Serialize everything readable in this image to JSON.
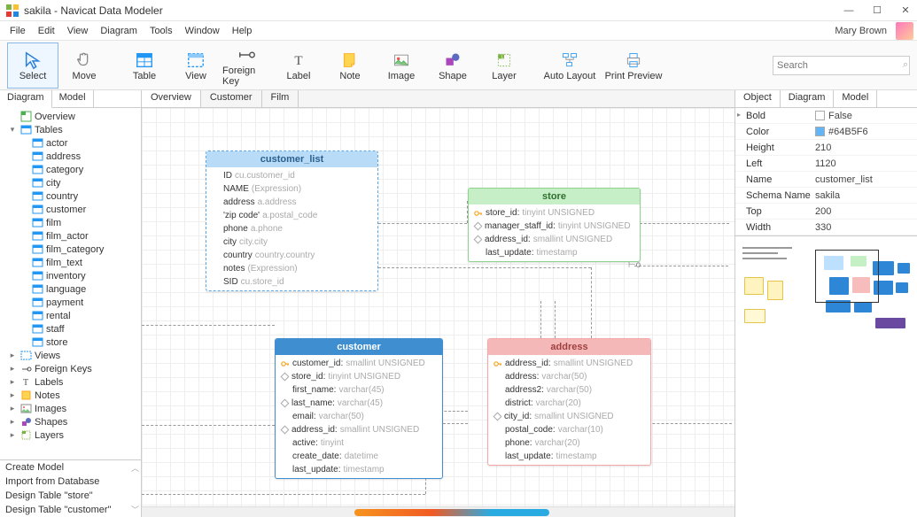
{
  "window": {
    "title": "sakila - Navicat Data Modeler"
  },
  "menu": {
    "items": [
      "File",
      "Edit",
      "View",
      "Diagram",
      "Tools",
      "Window",
      "Help"
    ],
    "user": "Mary Brown"
  },
  "toolbar": {
    "buttons": [
      {
        "id": "select",
        "label": "Select",
        "selected": true
      },
      {
        "id": "move",
        "label": "Move"
      },
      {
        "id": "table",
        "label": "Table"
      },
      {
        "id": "view",
        "label": "View"
      },
      {
        "id": "fk",
        "label": "Foreign Key"
      },
      {
        "id": "label",
        "label": "Label"
      },
      {
        "id": "note",
        "label": "Note"
      },
      {
        "id": "image",
        "label": "Image"
      },
      {
        "id": "shape",
        "label": "Shape"
      },
      {
        "id": "layer",
        "label": "Layer"
      },
      {
        "id": "autolayout",
        "label": "Auto Layout"
      },
      {
        "id": "printpreview",
        "label": "Print Preview"
      }
    ],
    "search_placeholder": "Search"
  },
  "left": {
    "tabs": [
      "Diagram",
      "Model"
    ],
    "tree": {
      "overview": "Overview",
      "tables_label": "Tables",
      "tables": [
        "actor",
        "address",
        "category",
        "city",
        "country",
        "customer",
        "film",
        "film_actor",
        "film_category",
        "film_text",
        "inventory",
        "language",
        "payment",
        "rental",
        "staff",
        "store"
      ],
      "groups": [
        "Views",
        "Foreign Keys",
        "Labels",
        "Notes",
        "Images",
        "Shapes",
        "Layers"
      ]
    },
    "bottom": [
      "Create Model",
      "Import from Database",
      "Design Table \"store\"",
      "Design Table \"customer\""
    ]
  },
  "canvas": {
    "tabs": [
      "Overview",
      "Customer",
      "Film"
    ],
    "entities": {
      "customer_list": {
        "title": "customer_list",
        "rows": [
          {
            "name": "ID",
            "type": "cu.customer_id"
          },
          {
            "name": "NAME",
            "type": "(Expression)"
          },
          {
            "name": "address",
            "type": "a.address"
          },
          {
            "name": "'zip code'",
            "type": "a.postal_code"
          },
          {
            "name": "phone",
            "type": "a.phone"
          },
          {
            "name": "city",
            "type": "city.city"
          },
          {
            "name": "country",
            "type": "country.country"
          },
          {
            "name": "notes",
            "type": "(Expression)"
          },
          {
            "name": "SID",
            "type": "cu.store_id"
          }
        ]
      },
      "store": {
        "title": "store",
        "rows": [
          {
            "icon": "key",
            "name": "store_id:",
            "type": "tinyint UNSIGNED"
          },
          {
            "icon": "diamond",
            "name": "manager_staff_id:",
            "type": "tinyint UNSIGNED"
          },
          {
            "icon": "diamond",
            "name": "address_id:",
            "type": "smallint UNSIGNED"
          },
          {
            "name": "last_update:",
            "type": "timestamp"
          }
        ]
      },
      "customer": {
        "title": "customer",
        "rows": [
          {
            "icon": "key",
            "name": "customer_id:",
            "type": "smallint UNSIGNED"
          },
          {
            "icon": "diamond",
            "name": "store_id:",
            "type": "tinyint UNSIGNED"
          },
          {
            "name": "first_name:",
            "type": "varchar(45)"
          },
          {
            "icon": "diamond",
            "name": "last_name:",
            "type": "varchar(45)"
          },
          {
            "name": "email:",
            "type": "varchar(50)"
          },
          {
            "icon": "diamond",
            "name": "address_id:",
            "type": "smallint UNSIGNED"
          },
          {
            "name": "active:",
            "type": "tinyint"
          },
          {
            "name": "create_date:",
            "type": "datetime"
          },
          {
            "name": "last_update:",
            "type": "timestamp"
          }
        ]
      },
      "address": {
        "title": "address",
        "rows": [
          {
            "icon": "key",
            "name": "address_id:",
            "type": "smallint UNSIGNED"
          },
          {
            "name": "address:",
            "type": "varchar(50)"
          },
          {
            "name": "address2:",
            "type": "varchar(50)"
          },
          {
            "name": "district:",
            "type": "varchar(20)"
          },
          {
            "icon": "diamond",
            "name": "city_id:",
            "type": "smallint UNSIGNED"
          },
          {
            "name": "postal_code:",
            "type": "varchar(10)"
          },
          {
            "name": "phone:",
            "type": "varchar(20)"
          },
          {
            "name": "last_update:",
            "type": "timestamp"
          }
        ]
      }
    }
  },
  "right": {
    "tabs": [
      "Object",
      "Diagram",
      "Model"
    ],
    "props": [
      {
        "k": "Bold",
        "v": "False",
        "swatch": "#ffffff"
      },
      {
        "k": "Color",
        "v": "#64B5F6",
        "swatch": "#64B5F6"
      },
      {
        "k": "Height",
        "v": "210"
      },
      {
        "k": "Left",
        "v": "1120"
      },
      {
        "k": "Name",
        "v": "customer_list"
      },
      {
        "k": "Schema Name",
        "v": "sakila"
      },
      {
        "k": "Top",
        "v": "200"
      },
      {
        "k": "Width",
        "v": "330"
      }
    ]
  }
}
